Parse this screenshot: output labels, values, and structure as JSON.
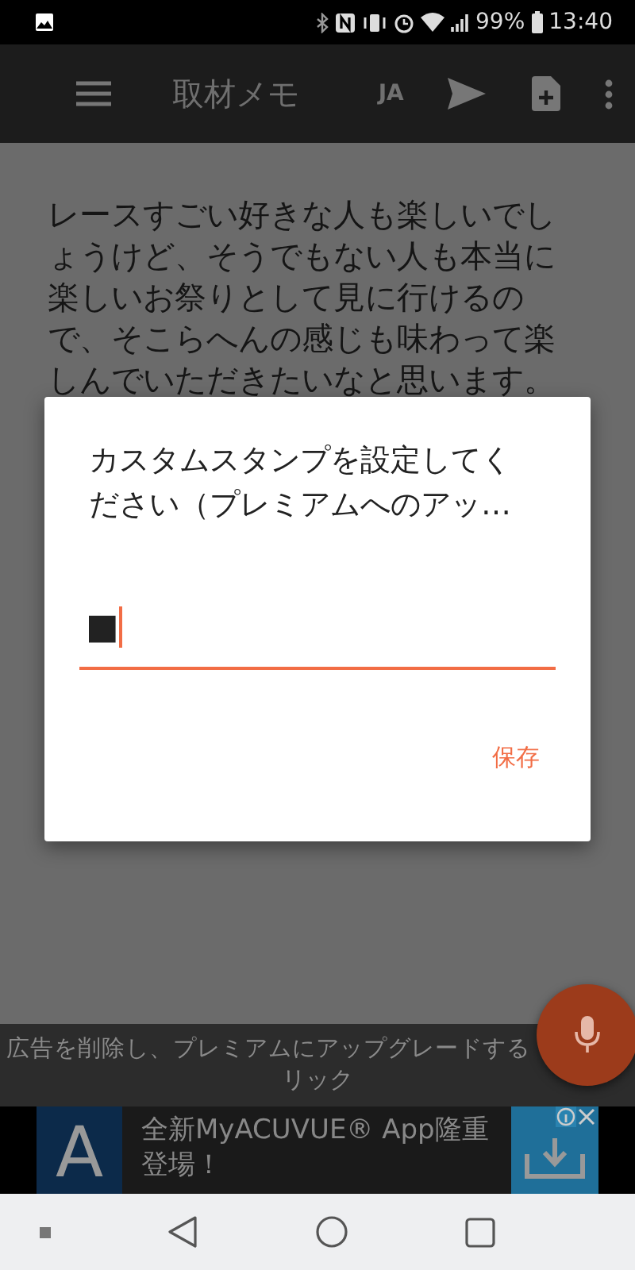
{
  "status_bar": {
    "battery": "99%",
    "time": "13:40"
  },
  "toolbar": {
    "title": "取材メモ",
    "language": "JA"
  },
  "memo": {
    "text": "レースすごい好きな人も楽しいでしょうけど、そうでもない人も本当に楽しいお祭りとして見に行けるので、そこらへんの感じも味わって楽しんでいただきたいなと思います。"
  },
  "dialog": {
    "title": "カスタムスタンプを設定してください（プレミアムへのアッ…",
    "field": {
      "value": "■",
      "focused": true
    },
    "buttons": [
      "保存"
    ]
  },
  "upgrade_banner": {
    "lines": [
      "広告を削除し、プレミアムにアップグレードする",
      "リック"
    ]
  },
  "ad": {
    "logo": "A",
    "headline": "全新MyACUVUE® App隆重登場！"
  }
}
